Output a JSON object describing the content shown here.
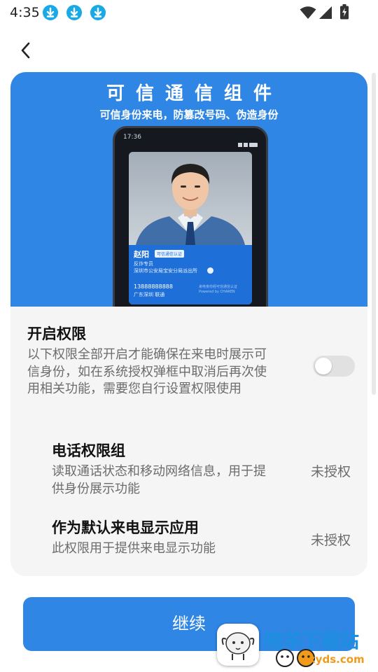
{
  "status_bar": {
    "time": "4:35",
    "icons": [
      "download-icon",
      "download-icon",
      "download-icon",
      "wifi-icon",
      "signal-icon",
      "battery-charging-icon"
    ]
  },
  "nav": {
    "back_icon": "chevron-left-icon"
  },
  "banner": {
    "title": "可信通信组件",
    "subtitle": "可信身份来电，防篡改号码、伪造身份",
    "phone": {
      "time": "17:36",
      "caller_name": "赵阳",
      "badge": "可信通信认证",
      "role": "反诈专员",
      "organization": "深圳市公安局宝安分局派出所",
      "number": "13888888888",
      "location": "广东深圳 联通",
      "powered_by_line1": "来电身份经可信通信认证",
      "powered_by_line2": "Powered by CHAREN"
    }
  },
  "permissions": {
    "title": "开启权限",
    "description": "以下权限全部开启才能确保在来电时展示可信身份，如在系统授权弹框中取消后再次使用相关功能，需要您自行设置权限使用",
    "toggle_on": false,
    "items": [
      {
        "title": "电话权限组",
        "description": "读取通话状态和移动网络信息，用于提供身份展示功能",
        "status": "未授权"
      },
      {
        "title": "作为默认来电显示应用",
        "description": "此权限用于提供来电显示功能",
        "status": "未授权"
      }
    ]
  },
  "continue_label": "继续",
  "watermark": {
    "text": "晓羊下载站",
    "url": "xyds.com"
  },
  "colors": {
    "primary": "#2f86e4",
    "card_bg": "#f5f5f5",
    "text_secondary": "#6c6c6c",
    "download_icon": "#19a9e6"
  }
}
